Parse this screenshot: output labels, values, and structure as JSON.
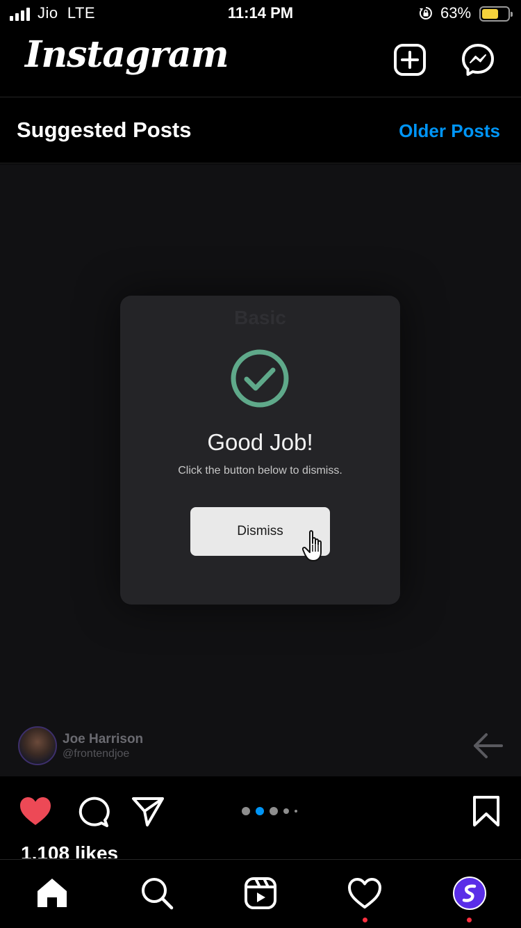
{
  "status_bar": {
    "carrier": "Jio",
    "network": "LTE",
    "time": "11:14 PM",
    "battery_percent": "63%",
    "battery_level": 0.63,
    "battery_color": "#f5d23c",
    "signal_bars": 4
  },
  "header": {
    "logo": "Instagram",
    "new_post_icon": "plus-square-icon",
    "messenger_icon": "messenger-icon"
  },
  "feed": {
    "section_title": "Suggested Posts",
    "older_posts_link": "Older Posts",
    "link_color": "#0095f6"
  },
  "post": {
    "card": {
      "faint_header": "Basic",
      "title": "Good Job!",
      "subtitle": "Click the button below to dismiss.",
      "button_label": "Dismiss",
      "check_color": "#5fa98a"
    },
    "author": {
      "name": "Joe Harrison",
      "handle": "@frontendjoe"
    },
    "carousel": {
      "count": 5,
      "active_index": 1,
      "active_color": "#0095f6"
    },
    "likes": "1,108 likes",
    "liked": true,
    "like_color": "#ed4956"
  },
  "tabbar": {
    "items": [
      {
        "name": "home",
        "icon": "home-icon"
      },
      {
        "name": "search",
        "icon": "search-icon"
      },
      {
        "name": "reels",
        "icon": "reels-icon"
      },
      {
        "name": "activity",
        "icon": "heart-icon",
        "badge": true
      },
      {
        "name": "profile",
        "icon": "profile-avatar",
        "badge": true
      }
    ],
    "badge_color": "#ff3040"
  }
}
